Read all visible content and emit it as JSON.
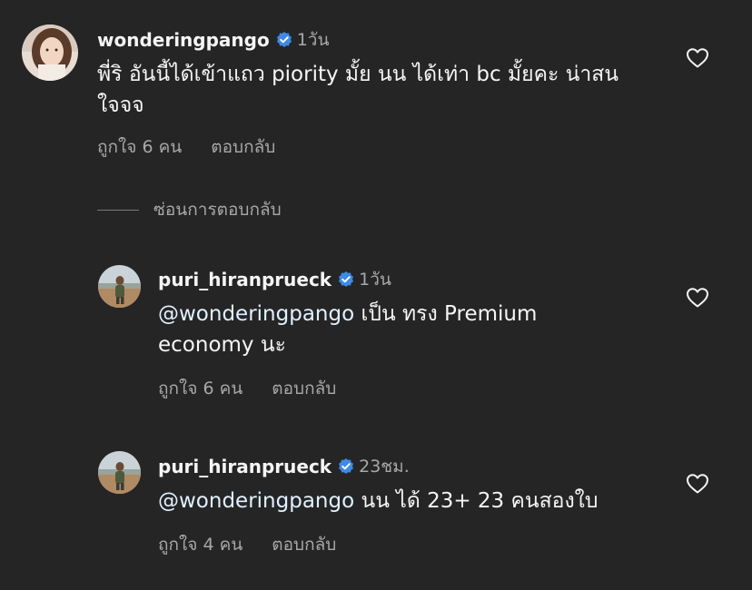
{
  "comments": [
    {
      "username": "wonderingpango",
      "verified": true,
      "time": "1วัน",
      "text_line1": "พี่ริ อันนี้ได้เข้าแถว piority มั้ย นน ได้เท่า bc มั้ยคะ น่าสน",
      "text_line2": "ใจจจ",
      "likes_label": "ถูกใจ 6 คน",
      "reply_label": "ตอบกลับ",
      "liked": false
    },
    {
      "username": "puri_hiranprueck",
      "verified": true,
      "time": "1วัน",
      "mention": "@wonderingpango",
      "text_line1": " เป็น ทรง Premium",
      "text_line2": "economy นะ",
      "likes_label": "ถูกใจ 6 คน",
      "reply_label": "ตอบกลับ",
      "liked": false
    },
    {
      "username": "puri_hiranprueck",
      "verified": true,
      "time": "23ชม.",
      "mention": "@wonderingpango",
      "text_line1": " นน ได้ 23+ 23 คนสองใบ",
      "likes_label": "ถูกใจ 4 คน",
      "reply_label": "ตอบกลับ",
      "liked": false
    }
  ],
  "hide_replies_label": "ซ่อนการตอบกลับ",
  "colors": {
    "background": "#252526",
    "text": "#f5f5f5",
    "secondary": "#a8a8a8",
    "mention": "#e0f1ff",
    "verified_badge": "#3f8ae5"
  },
  "icons": {
    "verified": "verified-badge-icon",
    "like": "heart-outline-icon"
  }
}
